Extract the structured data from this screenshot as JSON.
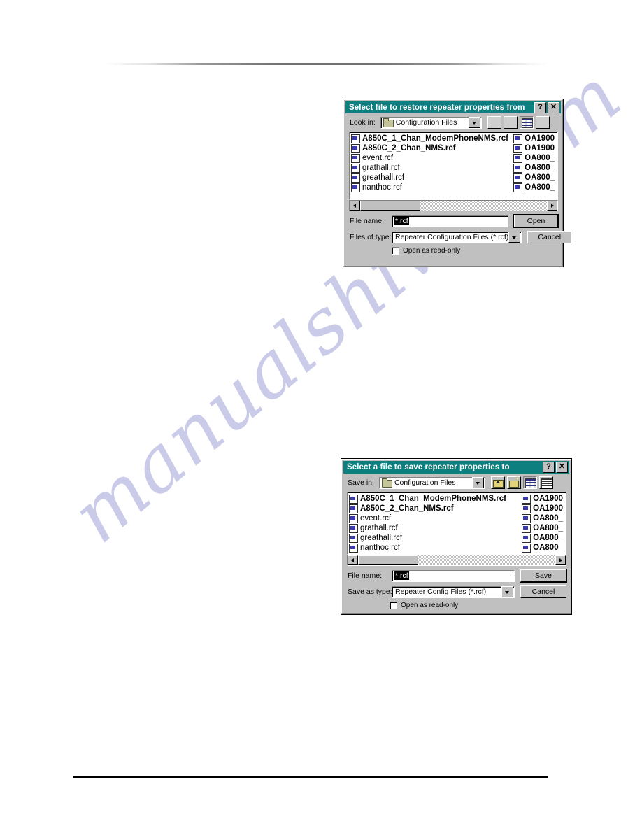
{
  "page": {
    "background": "#ffffff",
    "watermark_text": "manualshive.com",
    "watermark_color": "#c9cbe8"
  },
  "theme": {
    "titlebar_color": "#0e7f7f",
    "dialog_face": "#c0c0c0",
    "field_background": "#ffffff",
    "selection_color": "#000000"
  },
  "dialogs": [
    {
      "id": "open-dialog",
      "title": "Select file to restore repeater properties from",
      "titlebar_buttons": [
        {
          "name": "help-button",
          "glyph": "?"
        },
        {
          "name": "close-button",
          "glyph": "✕"
        }
      ],
      "lookin": {
        "label": "Look in:",
        "value": "Configuration Files",
        "icon": "folder-icon",
        "dropdown_icon": "chevron-down-icon"
      },
      "toolbar": [
        {
          "name": "up-one-level-button",
          "icon": "up-one-level-icon",
          "state": "faded"
        },
        {
          "name": "new-folder-button",
          "icon": "new-folder-icon",
          "state": "faded"
        },
        {
          "name": "list-view-button",
          "icon": "list-view-icon",
          "state": "pressed"
        },
        {
          "name": "details-view-button",
          "icon": "details-view-icon",
          "state": "normal"
        }
      ],
      "files_left": [
        {
          "name": "A850C_1_Chan_ModemPhoneNMS.rcf",
          "bold": true
        },
        {
          "name": "A850C_2_Chan_NMS.rcf",
          "bold": true
        },
        {
          "name": "event.rcf",
          "bold": false
        },
        {
          "name": "grathall.rcf",
          "bold": false
        },
        {
          "name": "greathall.rcf",
          "bold": false
        },
        {
          "name": "nanthoc.rcf",
          "bold": false
        }
      ],
      "files_right": [
        {
          "name": "OA1900",
          "bold": true
        },
        {
          "name": "OA1900",
          "bold": true
        },
        {
          "name": "OA800_",
          "bold": true
        },
        {
          "name": "OA800_",
          "bold": true
        },
        {
          "name": "OA800_",
          "bold": true
        },
        {
          "name": "OA800_",
          "bold": true
        }
      ],
      "scrollbar": {
        "left_arrow": "left-arrow-icon",
        "right_arrow": "right-arrow-icon"
      },
      "filename": {
        "label": "File name:",
        "value": "*.rcf",
        "selected": true
      },
      "filetype": {
        "label": "Files of type:",
        "value": "Repeater Configuration Files (*.rcf)",
        "dropdown_icon": "chevron-down-icon"
      },
      "readonly": {
        "label": "Open as read-only",
        "checked": false
      },
      "buttons": {
        "primary": "Open",
        "secondary": "Cancel"
      }
    },
    {
      "id": "save-dialog",
      "title": "Select a file to save repeater properties to",
      "titlebar_buttons": [
        {
          "name": "help-button",
          "glyph": "?"
        },
        {
          "name": "close-button",
          "glyph": "✕"
        }
      ],
      "lookin": {
        "label": "Save in:",
        "value": "Configuration Files",
        "icon": "folder-icon",
        "dropdown_icon": "chevron-down-icon"
      },
      "toolbar": [
        {
          "name": "up-one-level-button",
          "icon": "up-one-level-icon",
          "state": "normal"
        },
        {
          "name": "new-folder-button",
          "icon": "new-folder-icon",
          "state": "normal"
        },
        {
          "name": "list-view-button",
          "icon": "list-view-icon",
          "state": "pressed"
        },
        {
          "name": "details-view-button",
          "icon": "details-view-icon",
          "state": "normal"
        }
      ],
      "files_left": [
        {
          "name": "A850C_1_Chan_ModemPhoneNMS.rcf",
          "bold": true
        },
        {
          "name": "A850C_2_Chan_NMS.rcf",
          "bold": true
        },
        {
          "name": "event.rcf",
          "bold": false
        },
        {
          "name": "grathall.rcf",
          "bold": false
        },
        {
          "name": "greathall.rcf",
          "bold": false
        },
        {
          "name": "nanthoc.rcf",
          "bold": false
        }
      ],
      "files_right": [
        {
          "name": "OA1900",
          "bold": true
        },
        {
          "name": "OA1900",
          "bold": true
        },
        {
          "name": "OA800_",
          "bold": true
        },
        {
          "name": "OA800_",
          "bold": true
        },
        {
          "name": "OA800_",
          "bold": true
        },
        {
          "name": "OA800_",
          "bold": true
        }
      ],
      "scrollbar": {
        "left_arrow": "left-arrow-icon",
        "right_arrow": "right-arrow-icon"
      },
      "filename": {
        "label": "File name:",
        "value": "*.rcf",
        "selected": true
      },
      "filetype": {
        "label": "Save as type:",
        "value": "Repeater Config Files (*.rcf)",
        "dropdown_icon": "chevron-down-icon"
      },
      "readonly": {
        "label": "Open as read-only",
        "checked": false
      },
      "buttons": {
        "primary": "Save",
        "secondary": "Cancel"
      }
    }
  ]
}
